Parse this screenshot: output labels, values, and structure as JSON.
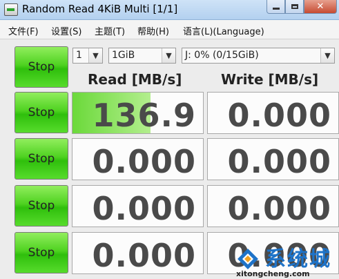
{
  "window": {
    "title": "Random Read 4KiB Multi [1/1]",
    "controls": {
      "minimize_icon": "minimize-icon",
      "maximize_icon": "maximize-icon",
      "close_label": "✕"
    }
  },
  "menu": {
    "items": [
      "文件(F)",
      "设置(S)",
      "主题(T)",
      "帮助(H)",
      "语言(L)(Language)"
    ]
  },
  "controls": {
    "count": "1",
    "size": "1GiB",
    "drive": "J: 0% (0/15GiB)",
    "dropdown_icon": "chevron-down-icon"
  },
  "headers": {
    "read": "Read [MB/s]",
    "write": "Write [MB/s]"
  },
  "stop_label": "Stop",
  "rows": [
    {
      "read": "136.9",
      "write": "0.000",
      "read_progress_percent": 60
    },
    {
      "read": "0.000",
      "write": "0.000",
      "read_progress_percent": 0
    },
    {
      "read": "0.000",
      "write": "0.000",
      "read_progress_percent": 0
    },
    {
      "read": "0.000",
      "write": "0.000",
      "read_progress_percent": 0
    }
  ],
  "watermark": {
    "title": "系统城",
    "site": "xitongcheng.com"
  },
  "colors": {
    "stop_green": "#4fd221",
    "progress_green": "#6bd93a",
    "watermark_blue": "#1e73c8"
  }
}
